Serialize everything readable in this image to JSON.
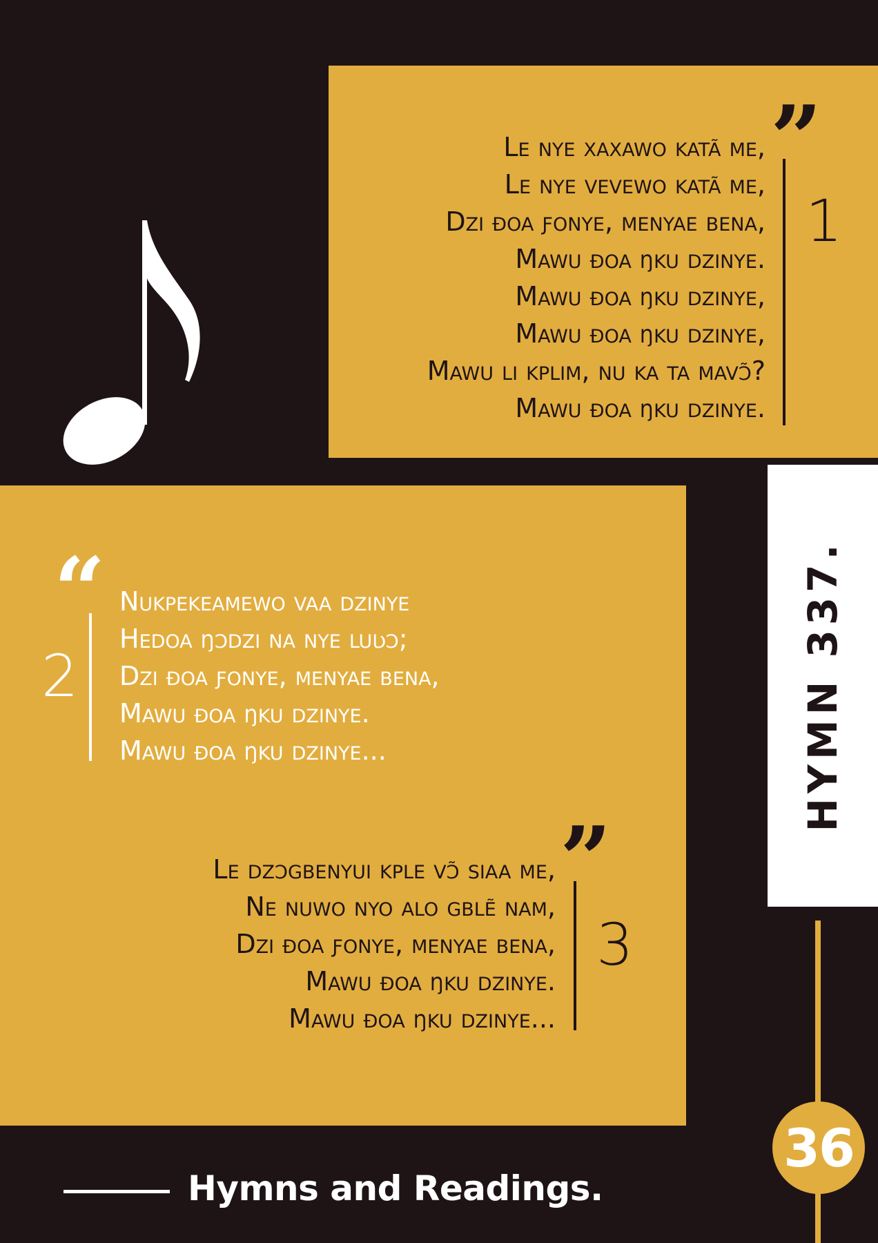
{
  "colors": {
    "background": "#1e1416",
    "accent": "#e2ad3f",
    "panel": "#ffffff"
  },
  "decoration": {
    "icon": "eighth-note-icon"
  },
  "hymn": {
    "title": "HYMN 337."
  },
  "verses": [
    {
      "number": "1",
      "quote_mark": "”",
      "lines": [
        "Le nye xaxawo katã me,",
        "Le nye vevewo katã me,",
        "Dzi ɖoa ƒonye, menyae bena,",
        "Mawu ɖoa ŋku dzinye.",
        "Mawu ɖoa ŋku dzinye,",
        "Mawu ɖoa ŋku dzinye,",
        "Mawu li kplim, nu ka ta mavɔ̃?",
        "Mawu ɖoa ŋku dzinye."
      ]
    },
    {
      "number": "2",
      "quote_mark": "“",
      "lines": [
        "Nukpekeamewo vaa dzinye",
        "Hedoa ŋɔdzi na nye luʋɔ;",
        "Dzi ɖoa ƒonye, menyae bena,",
        "Mawu ɖoa ŋku dzinye.",
        "Mawu ɖoa ŋku dzinye..."
      ]
    },
    {
      "number": "3",
      "quote_mark": "”",
      "lines": [
        "Le dzɔgbenyui kple vɔ̃ siaa me,",
        "Ne nuwo nyo alo gblẽ nam,",
        "Dzi ɖoa ƒonye, menyae bena,",
        "Mawu ɖoa ŋku dzinye.",
        "Mawu ɖoa ŋku dzinye..."
      ]
    }
  ],
  "page": {
    "number": "36"
  },
  "footer": {
    "title": "Hymns and Readings."
  }
}
